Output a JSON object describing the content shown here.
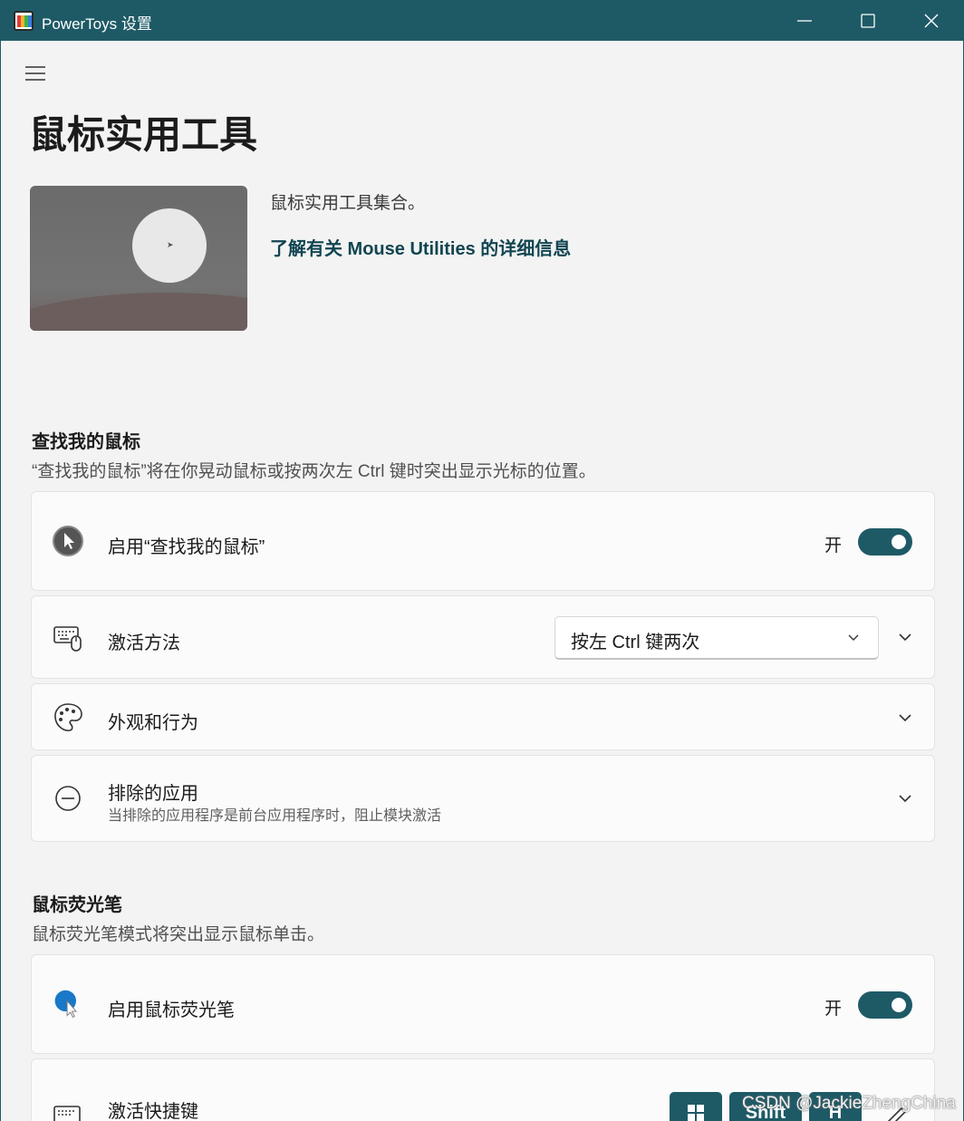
{
  "window": {
    "title": "PowerToys 设置",
    "accent_color": "#1e5a66"
  },
  "header": {
    "title": "鼠标实用工具",
    "description": "鼠标实用工具集合。",
    "learn_more": "了解有关 Mouse Utilities 的详细信息"
  },
  "find_my_mouse": {
    "title": "查找我的鼠标",
    "description": "“查找我的鼠标”将在你晃动鼠标或按两次左 Ctrl 键时突出显示光标的位置。",
    "enable_label": "启用“查找我的鼠标”",
    "enable_state": "开",
    "activation_label": "激活方法",
    "activation_value": "按左 Ctrl 键两次",
    "appearance_label": "外观和行为",
    "excluded_label": "排除的应用",
    "excluded_desc": "当排除的应用程序是前台应用程序时，阻止模块激活"
  },
  "highlighter": {
    "title": "鼠标荧光笔",
    "description": "鼠标荧光笔模式将突出显示鼠标单击。",
    "enable_label": "启用鼠标荧光笔",
    "enable_state": "开",
    "shortcut_label": "激活快捷键",
    "keys": [
      "",
      "Shift",
      "H"
    ]
  },
  "watermark": "CSDN @JackieZhengChina"
}
